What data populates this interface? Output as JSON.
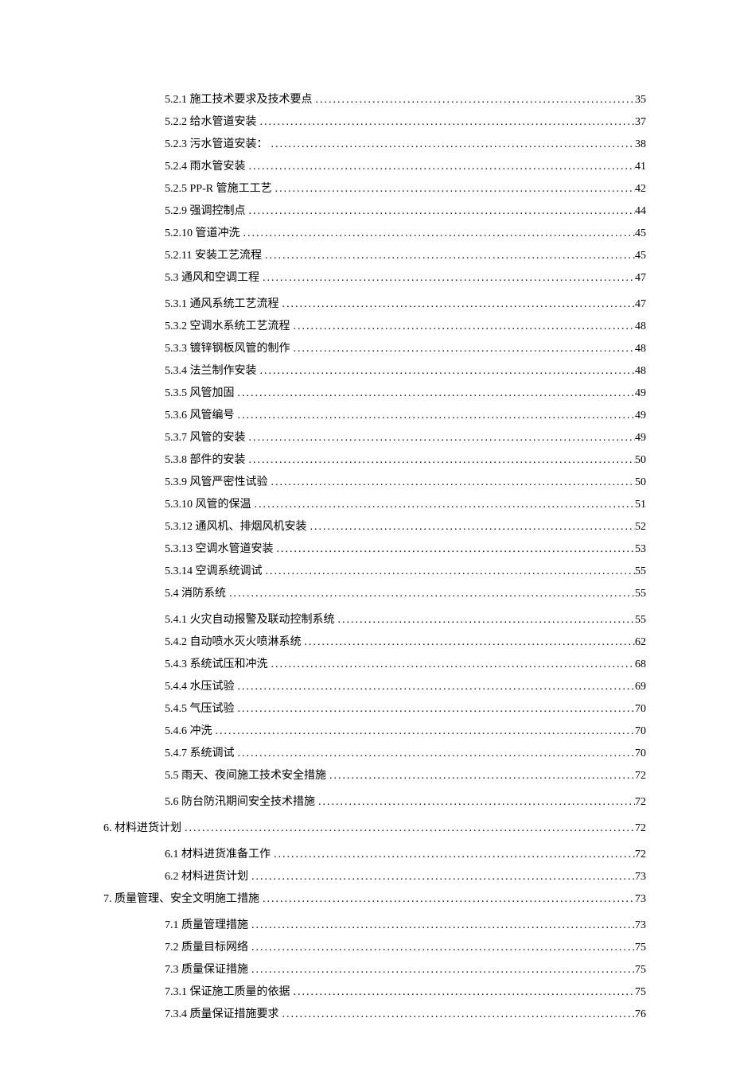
{
  "toc": [
    {
      "level": 3,
      "num": "5.2.1",
      "title": "施工技术要求及技术要点",
      "page": "35",
      "gap": false
    },
    {
      "level": 3,
      "num": "5.2.2",
      "title": "给水管道安装",
      "page": "37",
      "gap": false
    },
    {
      "level": 3,
      "num": "5.2.3",
      "title": "污水管道安装：",
      "page": "38",
      "gap": false
    },
    {
      "level": 3,
      "num": "5.2.4",
      "title": "雨水管安装",
      "page": "41",
      "gap": false
    },
    {
      "level": 3,
      "num": "5.2.5",
      "title": " PP-R 管施工工艺",
      "page": "42",
      "gap": false
    },
    {
      "level": 3,
      "num": "5.2.9",
      "title": "强调控制点",
      "page": "44",
      "gap": false
    },
    {
      "level": 3,
      "num": "5.2.10",
      "title": "管道冲洗",
      "page": "45",
      "gap": false
    },
    {
      "level": 3,
      "num": "5.2.11",
      "title": "安装工艺流程",
      "page": "45",
      "gap": false
    },
    {
      "level": 2,
      "num": "5.3",
      "title": " 通风和空调工程",
      "page": "47",
      "gap": false
    },
    {
      "level": 3,
      "num": "5.3.1",
      "title": " 通风系统工艺流程",
      "page": "47",
      "gap": true
    },
    {
      "level": 3,
      "num": "5.3.2",
      "title": " 空调水系统工艺流程",
      "page": "48",
      "gap": false
    },
    {
      "level": 3,
      "num": "5.3.3",
      "title": " 镀锌钢板风管的制作",
      "page": "48",
      "gap": false
    },
    {
      "level": 3,
      "num": "5.3.4",
      "title": "法兰制作安装",
      "page": "48",
      "gap": false
    },
    {
      "level": 3,
      "num": "5.3.5",
      "title": " 风管加固",
      "page": "49",
      "gap": false
    },
    {
      "level": 3,
      "num": "5.3.6",
      "title": " 风管编号",
      "page": "49",
      "gap": false
    },
    {
      "level": 3,
      "num": "5.3.7",
      "title": "风管的安装",
      "page": "49",
      "gap": false
    },
    {
      "level": 3,
      "num": "5.3.8",
      "title": "部件的安装",
      "page": "50",
      "gap": false
    },
    {
      "level": 3,
      "num": "5.3.9",
      "title": "风管严密性试验",
      "page": "50",
      "gap": false
    },
    {
      "level": 3,
      "num": "5.3.10",
      "title": " 风管的保温",
      "page": "51",
      "gap": false
    },
    {
      "level": 3,
      "num": "5.3.12",
      "title": "通风机、排烟风机安装",
      "page": "52",
      "gap": false
    },
    {
      "level": 3,
      "num": "5.3.13",
      "title": "空调水管道安装",
      "page": "53",
      "gap": false
    },
    {
      "level": 3,
      "num": "5.3.14",
      "title": " 空调系统调试",
      "page": "55",
      "gap": false
    },
    {
      "level": 2,
      "num": "5.4",
      "title": "消防系统",
      "page": "55",
      "gap": false
    },
    {
      "level": 3,
      "num": "5.4.1",
      "title": " 火灾自动报警及联动控制系统",
      "page": "55",
      "gap": true
    },
    {
      "level": 3,
      "num": "5.4.2",
      "title": "自动喷水灭火喷淋系统",
      "page": "62",
      "gap": false
    },
    {
      "level": 3,
      "num": "5.4.3",
      "title": "系统试压和冲洗",
      "page": "68",
      "gap": false
    },
    {
      "level": 3,
      "num": "5.4.4",
      "title": "水压试验",
      "page": "69",
      "gap": false
    },
    {
      "level": 3,
      "num": "5.4.5",
      "title": "气压试验",
      "page": "70",
      "gap": false
    },
    {
      "level": 3,
      "num": "5.4.6",
      "title": " 冲洗",
      "page": "70",
      "gap": false
    },
    {
      "level": 3,
      "num": "5.4.7",
      "title": "系统调试",
      "page": "70",
      "gap": false
    },
    {
      "level": 2,
      "num": "5.5",
      "title": "雨天、夜间施工技术安全措施",
      "page": "72",
      "gap": false
    },
    {
      "level": 2,
      "num": "5.6",
      "title": "防台防汛期间安全技术措施",
      "page": "72",
      "gap": true
    },
    {
      "level": 1,
      "num": "6.",
      "title": "材料进货计划",
      "page": "72",
      "gap": true
    },
    {
      "level": 2,
      "num": "6.1",
      "title": " 材料进货准备工作",
      "page": "72",
      "gap": true
    },
    {
      "level": 2,
      "num": "6.2",
      "title": " 材料进货计划",
      "page": "73",
      "gap": false
    },
    {
      "level": 1,
      "num": "7.",
      "title": " 质量管理、安全文明施工措施",
      "page": "73",
      "gap": false
    },
    {
      "level": 2,
      "num": "7.1",
      "title": "质量管理措施",
      "page": "73",
      "gap": true
    },
    {
      "level": 2,
      "num": "7.2",
      "title": "质量目标网络",
      "page": "75",
      "gap": false
    },
    {
      "level": 2,
      "num": "7.3",
      "title": "质量保证措施",
      "page": "75",
      "gap": false
    },
    {
      "level": 3,
      "num": "7.3.1",
      "title": "保证施工质量的依据",
      "page": "75",
      "gap": false
    },
    {
      "level": 3,
      "num": "7.3.4",
      "title": "质量保证措施要求",
      "page": "76",
      "gap": false
    }
  ]
}
